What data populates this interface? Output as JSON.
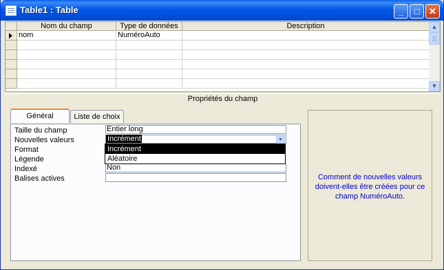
{
  "window": {
    "title": "Table1 : Table"
  },
  "titlebar_buttons": {
    "minimize": "_",
    "maximize": "□",
    "close": "✕"
  },
  "grid": {
    "columns": [
      "Nom du champ",
      "Type de données",
      "Description"
    ],
    "rows": [
      {
        "name": "nom",
        "type": "NuméroAuto",
        "description": ""
      }
    ],
    "scroll_up": "▲",
    "scroll_down": "▼"
  },
  "properties": {
    "header": "Propriétés du champ",
    "tabs": [
      "Général",
      "Liste de choix"
    ],
    "fields": [
      {
        "label": "Taille du champ",
        "value": "Entier long"
      },
      {
        "label": "Nouvelles valeurs",
        "value": "Incrément"
      },
      {
        "label": "Format",
        "value": ""
      },
      {
        "label": "Légende",
        "value": ""
      },
      {
        "label": "Indexé",
        "value": "Non"
      },
      {
        "label": "Balises actives",
        "value": ""
      }
    ],
    "dropdown_options": [
      "Incrément",
      "Aléatoire"
    ],
    "combo_arrow": "▼"
  },
  "help": {
    "text": "Comment de nouvelles valeurs doivent-elles être créées pour ce champ NuméroAuto."
  },
  "colors": {
    "titlebar": "#0058e6",
    "help_text": "#0000cc",
    "tab_accent": "#e68b2c"
  }
}
